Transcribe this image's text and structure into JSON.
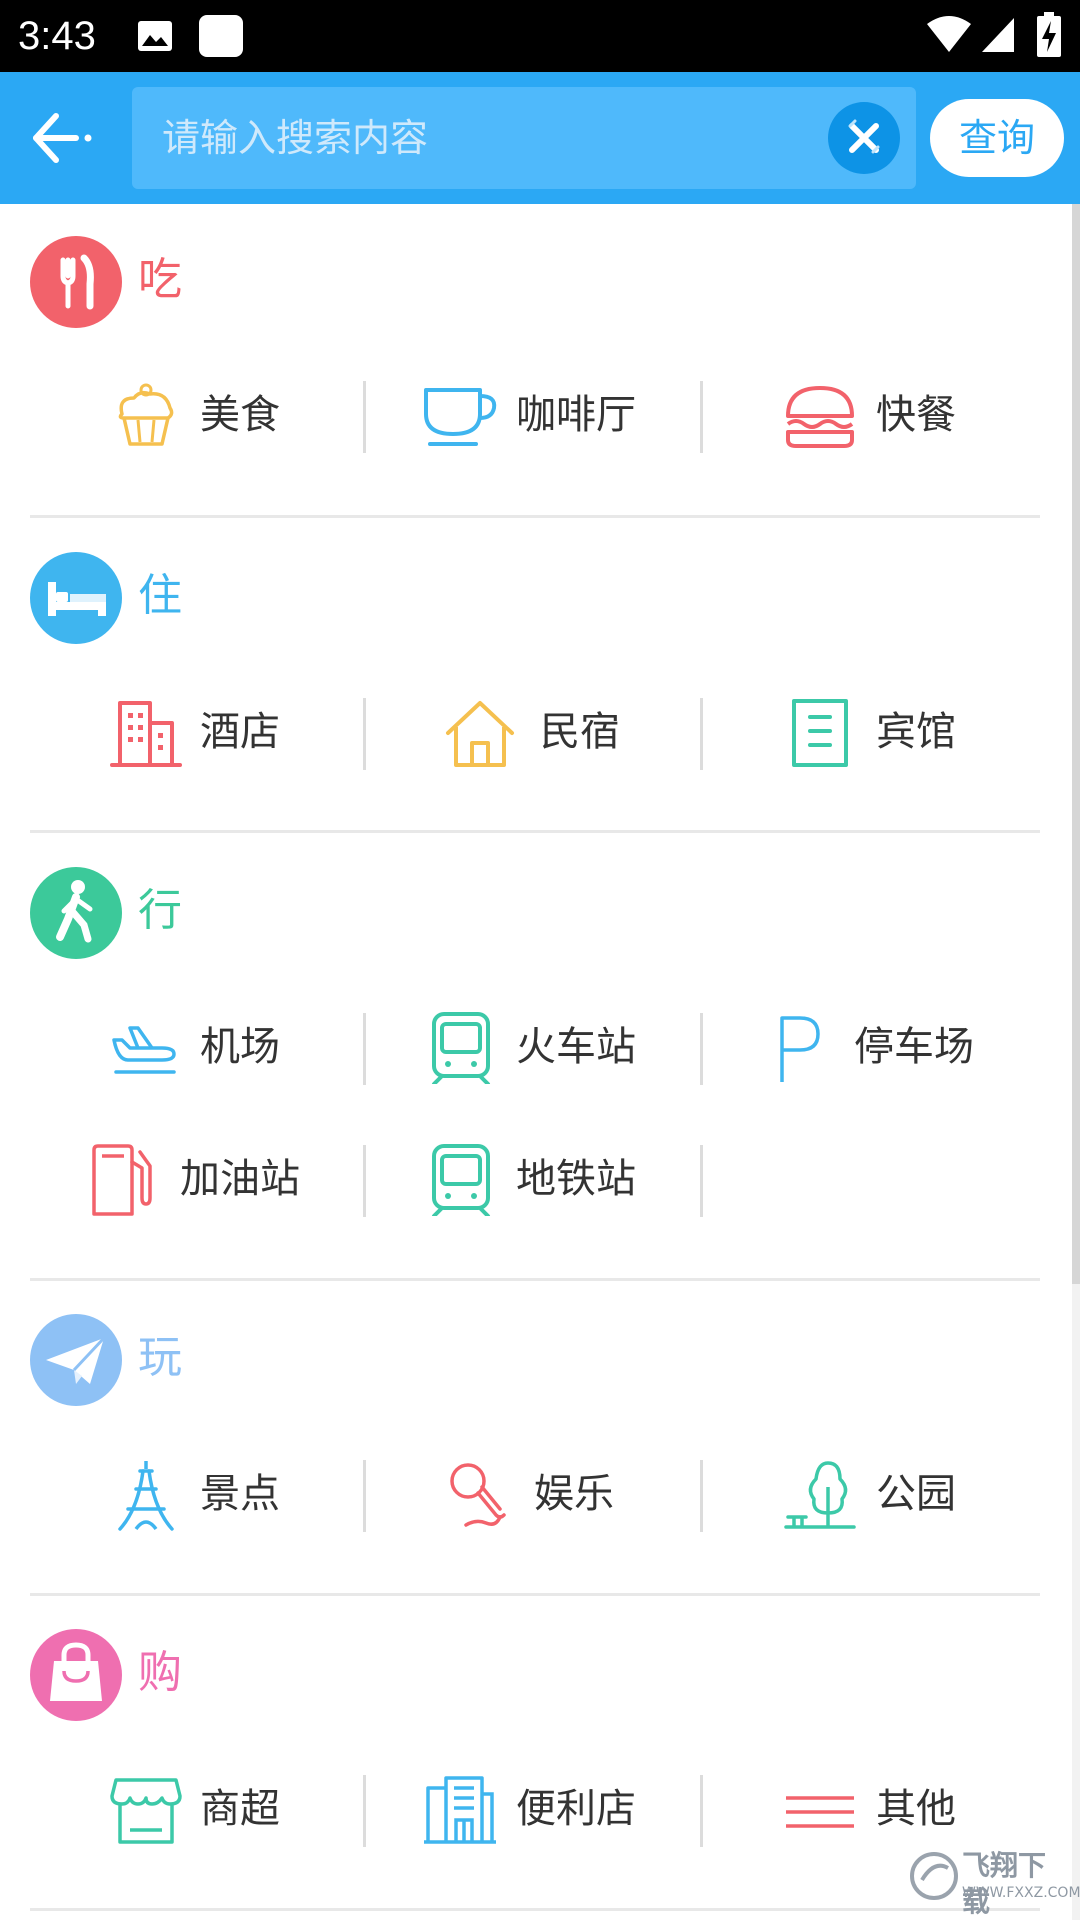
{
  "status_bar": {
    "time": "3:43"
  },
  "search": {
    "placeholder": "请输入搜索内容",
    "value": "",
    "query_label": "查询"
  },
  "colors": {
    "accent": "#2ba8f4",
    "eat": "#f2626b",
    "stay": "#3fb5ef",
    "go": "#3cc99a",
    "play": "#8ec1f5",
    "shop": "#ef6fb0"
  },
  "sections": [
    {
      "title": "吃",
      "icon": "fork-knife-icon",
      "items": [
        {
          "label": "美食",
          "icon": "cupcake-icon"
        },
        {
          "label": "咖啡厅",
          "icon": "coffee-cup-icon"
        },
        {
          "label": "快餐",
          "icon": "burger-icon"
        }
      ]
    },
    {
      "title": "住",
      "icon": "bed-icon",
      "items": [
        {
          "label": "酒店",
          "icon": "building-icon"
        },
        {
          "label": "民宿",
          "icon": "house-icon"
        },
        {
          "label": "宾馆",
          "icon": "guesthouse-icon"
        }
      ]
    },
    {
      "title": "行",
      "icon": "walking-person-icon",
      "items": [
        {
          "label": "机场",
          "icon": "airplane-icon"
        },
        {
          "label": "火车站",
          "icon": "train-icon"
        },
        {
          "label": "停车场",
          "icon": "parking-icon"
        },
        {
          "label": "加油站",
          "icon": "fuel-pump-icon"
        },
        {
          "label": "地铁站",
          "icon": "subway-icon"
        }
      ]
    },
    {
      "title": "玩",
      "icon": "paper-plane-icon",
      "items": [
        {
          "label": "景点",
          "icon": "tower-icon"
        },
        {
          "label": "娱乐",
          "icon": "microphone-icon"
        },
        {
          "label": "公园",
          "icon": "tree-icon"
        }
      ]
    },
    {
      "title": "购",
      "icon": "shopping-bag-icon",
      "items": [
        {
          "label": "商超",
          "icon": "store-icon"
        },
        {
          "label": "便利店",
          "icon": "shop-building-icon"
        },
        {
          "label": "其他",
          "icon": "lines-icon"
        }
      ]
    }
  ],
  "watermark": {
    "text": "飞翔下载",
    "subtext": "WWW.FXXZ.COM"
  }
}
